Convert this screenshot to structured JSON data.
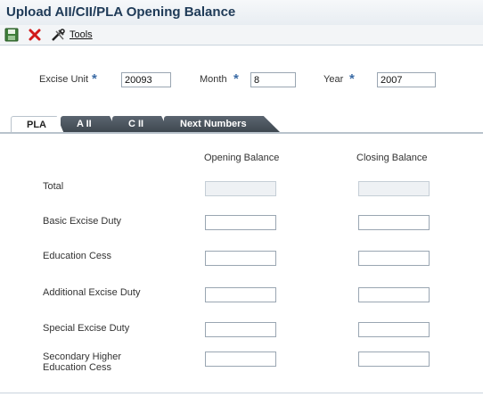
{
  "title": "Upload AII/CII/PLA Opening Balance",
  "toolbar": {
    "save_icon": "save-icon",
    "cancel_icon": "cancel-icon",
    "tools_icon": "tools-icon",
    "tools_label": "Tools"
  },
  "header": {
    "excise_unit_label": "Excise Unit",
    "excise_unit_value": "20093",
    "month_label": "Month",
    "month_value": "8",
    "year_label": "Year",
    "year_value": "2007",
    "required_marker": "*"
  },
  "tabs": [
    {
      "label": "PLA",
      "active": true
    },
    {
      "label": "A II",
      "active": false
    },
    {
      "label": "C II",
      "active": false
    },
    {
      "label": "Next Numbers",
      "active": false
    }
  ],
  "grid": {
    "opening_header": "Opening Balance",
    "closing_header": "Closing Balance",
    "rows": [
      {
        "label": "Total",
        "opening": "",
        "closing": "",
        "read_only": true
      },
      {
        "label": "Basic Excise Duty",
        "opening": "",
        "closing": "",
        "read_only": false
      },
      {
        "label": "Education Cess",
        "opening": "",
        "closing": "",
        "read_only": false
      },
      {
        "label": "Additional Excise Duty",
        "opening": "",
        "closing": "",
        "read_only": false
      },
      {
        "label": "Special Excise Duty",
        "opening": "",
        "closing": "",
        "read_only": false
      },
      {
        "label_line1": "Secondary Higher",
        "label_line2": "Education Cess",
        "opening": "",
        "closing": "",
        "read_only": false
      }
    ]
  },
  "colors": {
    "title": "#1e3a57",
    "required": "#3b6ba5",
    "tab_dark": "#4a535c"
  }
}
